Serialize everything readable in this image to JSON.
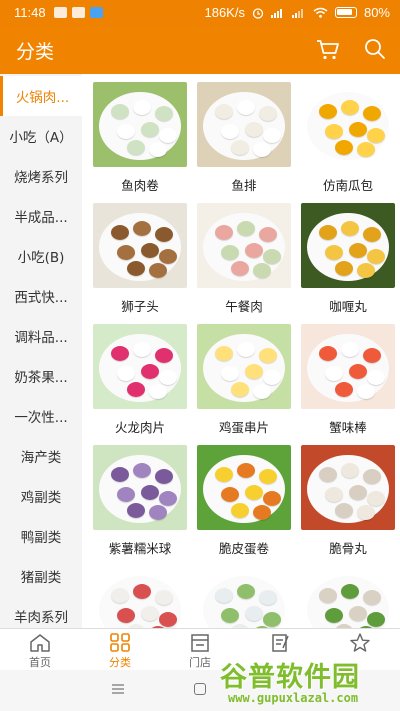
{
  "status": {
    "time": "11:48",
    "network": "186K/s",
    "battery": "80%"
  },
  "header": {
    "title": "分类",
    "cart_icon": "cart-icon",
    "search_icon": "search-icon"
  },
  "sidebar": {
    "items": [
      {
        "label": "火锅肉...",
        "active": true
      },
      {
        "label": "小吃（A）"
      },
      {
        "label": "烧烤系列"
      },
      {
        "label": "半成品..."
      },
      {
        "label": "小吃(B)"
      },
      {
        "label": "西式快..."
      },
      {
        "label": "调料品..."
      },
      {
        "label": "奶茶果..."
      },
      {
        "label": "一次性..."
      },
      {
        "label": "海产类"
      },
      {
        "label": "鸡副类"
      },
      {
        "label": "鸭副类"
      },
      {
        "label": "猪副类"
      },
      {
        "label": "羊肉系列"
      }
    ]
  },
  "products": [
    {
      "name": "鱼肉卷",
      "colors": [
        "#cfe3c4",
        "#ffffff",
        "#9bbf6a"
      ]
    },
    {
      "name": "鱼排",
      "colors": [
        "#f2ede2",
        "#ffffff",
        "#ddd2b8"
      ]
    },
    {
      "name": "仿南瓜包",
      "colors": [
        "#f0a800",
        "#ffd24a",
        "#ffffff"
      ]
    },
    {
      "name": "狮子头",
      "colors": [
        "#8a5a2e",
        "#a5703f",
        "#e9e4da"
      ]
    },
    {
      "name": "午餐肉",
      "colors": [
        "#e9a7a0",
        "#c9d9b0",
        "#f4f0e8"
      ]
    },
    {
      "name": "咖喱丸",
      "colors": [
        "#e2a21a",
        "#f4c542",
        "#3c5a22"
      ]
    },
    {
      "name": "火龙肉片",
      "colors": [
        "#e0306e",
        "#ffffff",
        "#d4eac9"
      ]
    },
    {
      "name": "鸡蛋串片",
      "colors": [
        "#ffe07a",
        "#ffffff",
        "#c6dfa4"
      ]
    },
    {
      "name": "蟹味棒",
      "colors": [
        "#ef5a3a",
        "#ffffff",
        "#f6e6dc"
      ]
    },
    {
      "name": "紫薯糯米球",
      "colors": [
        "#7a5a9a",
        "#9f84bf",
        "#cfe4c0"
      ]
    },
    {
      "name": "脆皮蛋卷",
      "colors": [
        "#f7d02f",
        "#e57a22",
        "#5ea33a"
      ]
    },
    {
      "name": "脆骨丸",
      "colors": [
        "#d8cfc2",
        "#eee8df",
        "#c24a2a"
      ]
    },
    {
      "name": "",
      "colors": [
        "#f0efeb",
        "#d85050",
        "#ffffff"
      ]
    },
    {
      "name": "",
      "colors": [
        "#e8eef0",
        "#8fbf6a",
        "#ffffff"
      ]
    },
    {
      "name": "",
      "colors": [
        "#d9d1c4",
        "#5f9c3c",
        "#ffffff"
      ]
    }
  ],
  "tabbar": {
    "tabs": [
      {
        "label": "首页",
        "icon": "home-icon"
      },
      {
        "label": "分类",
        "icon": "category-icon",
        "active": true
      },
      {
        "label": "门店",
        "icon": "store-icon"
      },
      {
        "label": "",
        "icon": "order-icon"
      },
      {
        "label": "",
        "icon": "star-icon"
      }
    ]
  },
  "watermark": {
    "title": "谷普软件园",
    "url": "www.gupuxlazal.com"
  },
  "accent_color": "#f08300"
}
